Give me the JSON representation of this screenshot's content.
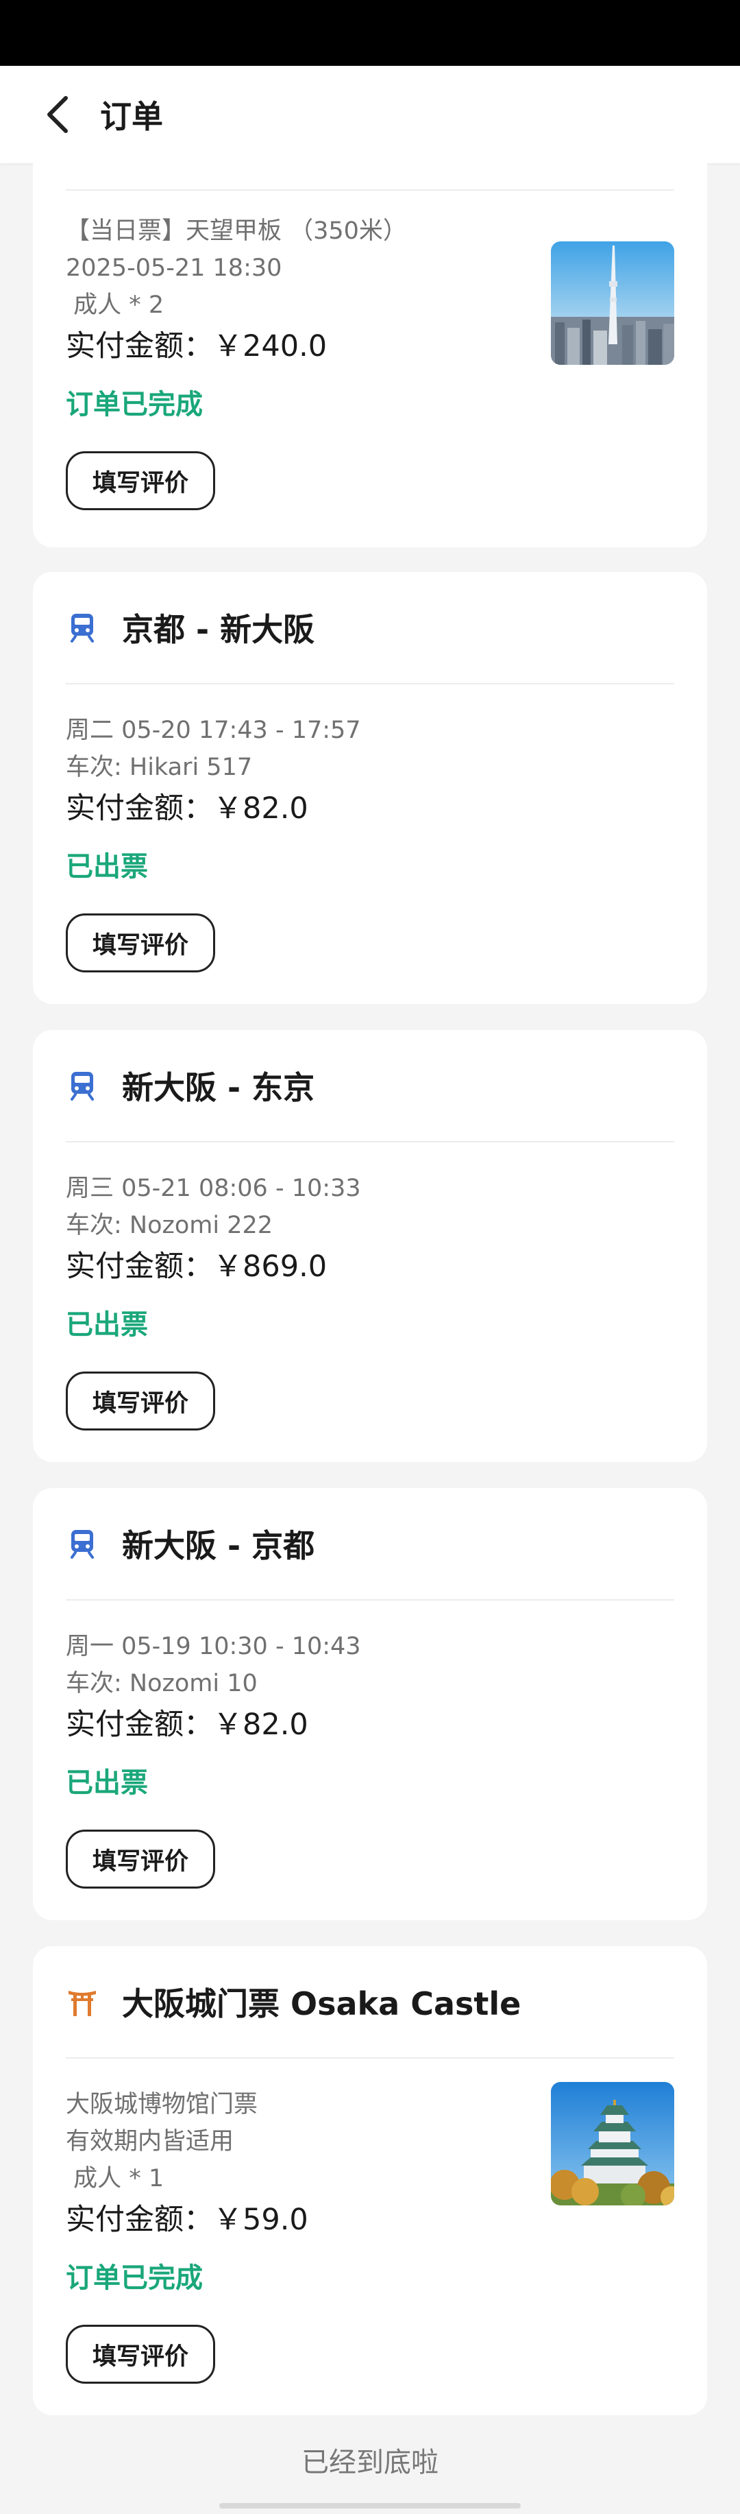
{
  "header": {
    "title": "订单"
  },
  "icons": {
    "back": "chevron-left-icon",
    "train": "train-icon",
    "attraction": "torii-gate-icon"
  },
  "colors": {
    "status_green": "#1aa77a",
    "train_blue": "#3b6fd1",
    "torii_orange": "#e07a2e"
  },
  "orders": [
    {
      "lines": [
        "【当日票】天望甲板 （350米）",
        "2025-05-21 18:30",
        " 成人 * 2"
      ],
      "amount": "实付金额：￥240.0",
      "status": "订单已完成",
      "review": "填写评价",
      "image": "tokyo-skytree-thumbnail"
    },
    {
      "title": "京都 - 新大阪",
      "lines": [
        "周二 05-20 17:43 - 17:57",
        "车次: Hikari 517"
      ],
      "amount": "实付金额：￥82.0",
      "status": "已出票",
      "review": "填写评价"
    },
    {
      "title": "新大阪 - 东京",
      "lines": [
        "周三 05-21 08:06 - 10:33",
        "车次: Nozomi 222"
      ],
      "amount": "实付金额：￥869.0",
      "status": "已出票",
      "review": "填写评价"
    },
    {
      "title": "新大阪 - 京都",
      "lines": [
        "周一 05-19 10:30 - 10:43",
        "车次: Nozomi 10"
      ],
      "amount": "实付金额：￥82.0",
      "status": "已出票",
      "review": "填写评价"
    },
    {
      "title": "大阪城门票 Osaka Castle",
      "lines": [
        "大阪城博物馆门票",
        "有效期内皆适用",
        " 成人 * 1"
      ],
      "amount": "实付金额：￥59.0",
      "status": "订单已完成",
      "review": "填写评价",
      "image": "osaka-castle-thumbnail"
    }
  ],
  "footer": "已经到底啦"
}
